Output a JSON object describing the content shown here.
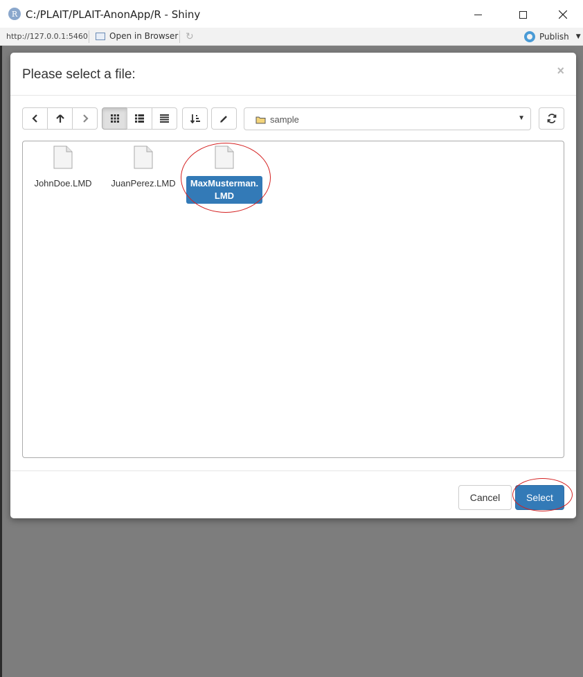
{
  "window": {
    "title": "C:/PLAIT/PLAIT-AnonApp/R - Shiny",
    "logo_letter": "R"
  },
  "toolbar": {
    "url": "http://127.0.0.1:5460",
    "open_in_browser": "Open in Browser",
    "publish": "Publish"
  },
  "modal": {
    "title": "Please select a file:",
    "close": "×",
    "current_folder": "sample",
    "view_mode": "icons",
    "files": [
      {
        "name": "JohnDoe.LMD",
        "selected": false
      },
      {
        "name": "JuanPerez.LMD",
        "selected": false
      },
      {
        "name": "MaxMusterman.LMD",
        "selected": true
      }
    ],
    "cancel_label": "Cancel",
    "select_label": "Select"
  },
  "colors": {
    "primary": "#337ab7",
    "annotation": "#d42020"
  }
}
